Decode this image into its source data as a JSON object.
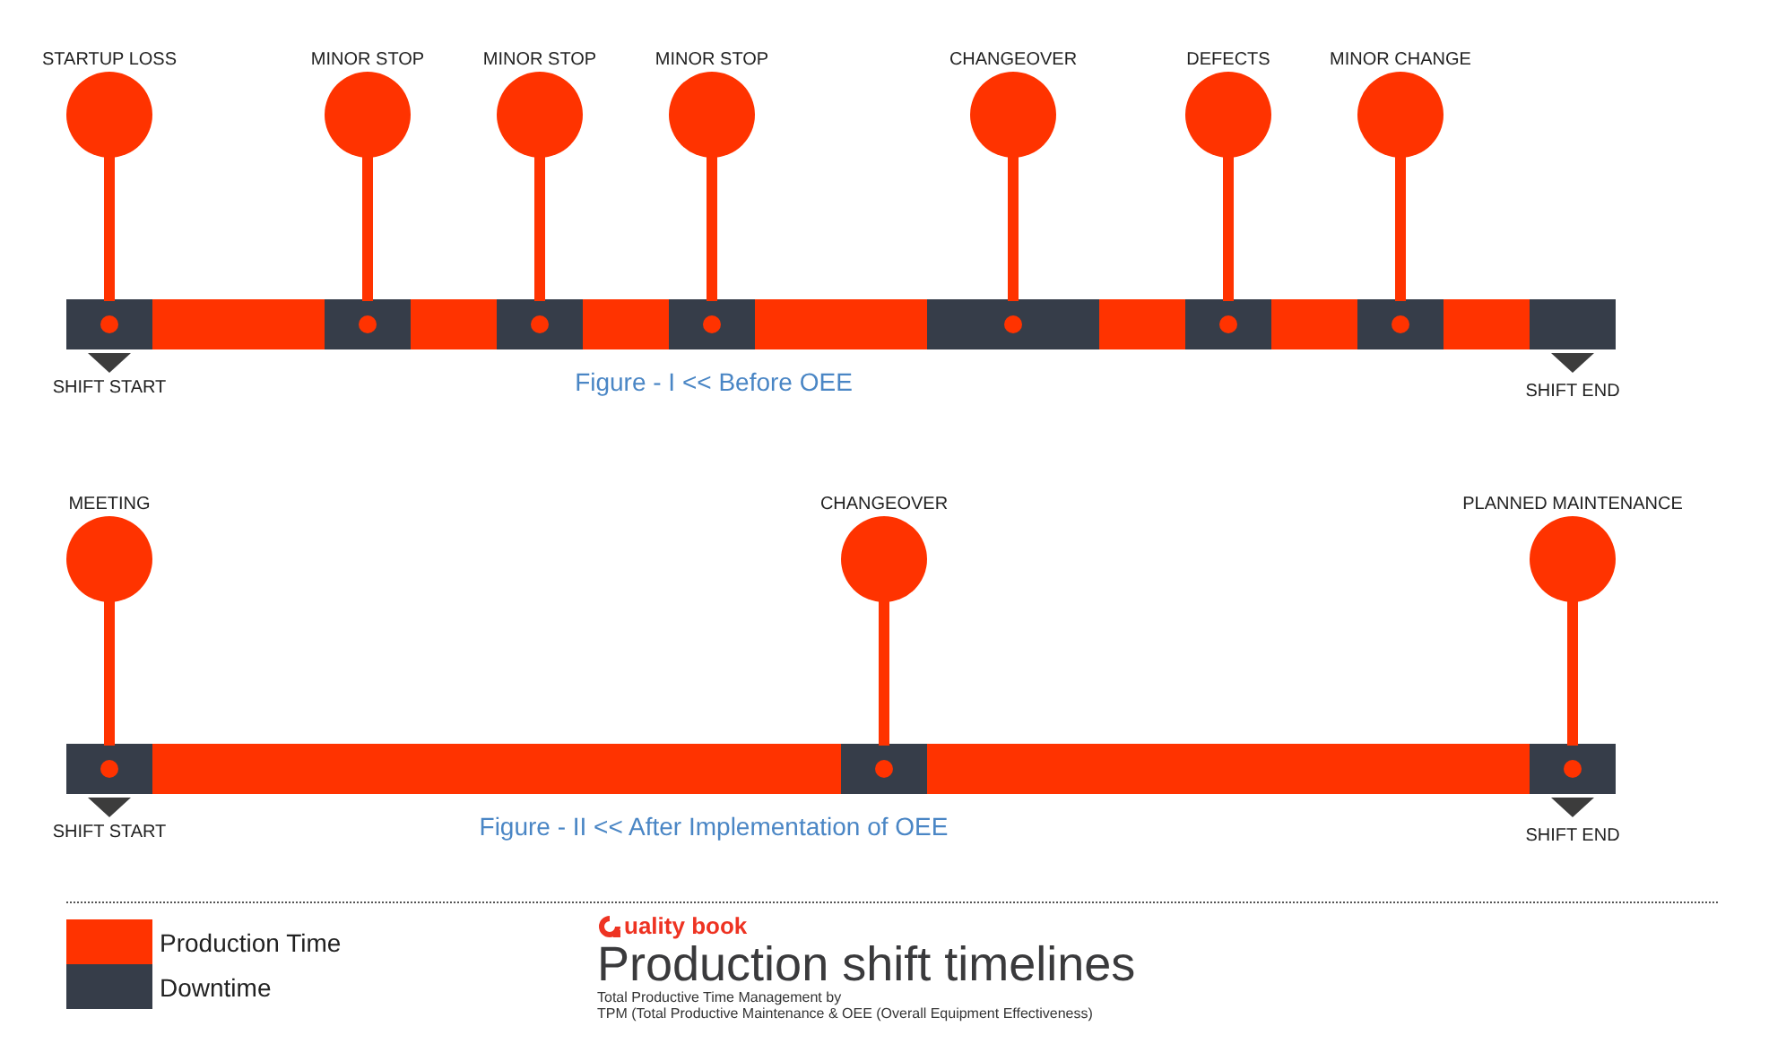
{
  "timelines": [
    {
      "caption": "Figure -  I << Before OEE",
      "start_label": "SHIFT START",
      "end_label": "SHIFT END",
      "cells": [
        {
          "kind": "downtime",
          "event": "STARTUP LOSS"
        },
        {
          "kind": "production"
        },
        {
          "kind": "production"
        },
        {
          "kind": "downtime",
          "event": "MINOR STOP"
        },
        {
          "kind": "production"
        },
        {
          "kind": "downtime",
          "event": "MINOR STOP"
        },
        {
          "kind": "production"
        },
        {
          "kind": "downtime",
          "event": "MINOR STOP"
        },
        {
          "kind": "production"
        },
        {
          "kind": "production"
        },
        {
          "kind": "downtime",
          "event": "CHANGEOVER"
        },
        {
          "kind": "downtime"
        },
        {
          "kind": "production"
        },
        {
          "kind": "downtime",
          "event": "DEFECTS"
        },
        {
          "kind": "production"
        },
        {
          "kind": "downtime",
          "event": "MINOR CHANGE"
        },
        {
          "kind": "production"
        },
        {
          "kind": "downtime"
        }
      ]
    },
    {
      "caption": "Figure -  II << After Implementation of OEE",
      "start_label": "SHIFT START",
      "end_label": "SHIFT END",
      "cells": [
        {
          "kind": "downtime",
          "event": "MEETING"
        },
        {
          "kind": "production"
        },
        {
          "kind": "production"
        },
        {
          "kind": "production"
        },
        {
          "kind": "production"
        },
        {
          "kind": "production"
        },
        {
          "kind": "production"
        },
        {
          "kind": "production"
        },
        {
          "kind": "production"
        },
        {
          "kind": "downtime",
          "event": "CHANGEOVER"
        },
        {
          "kind": "production"
        },
        {
          "kind": "production"
        },
        {
          "kind": "production"
        },
        {
          "kind": "production"
        },
        {
          "kind": "production"
        },
        {
          "kind": "production"
        },
        {
          "kind": "production"
        },
        {
          "kind": "downtime",
          "event": "PLANNED MAINTENANCE"
        }
      ]
    }
  ],
  "legend": [
    {
      "kind": "production",
      "label": "Production Time"
    },
    {
      "kind": "downtime",
      "label": "Downtime"
    }
  ],
  "brand": "uality book",
  "title": "Production shift timelines",
  "subtitle_lines": [
    "Total Productive Time Management  by",
    "TPM  (Total  Productive Maintenance & OEE  (Overall Equipment Effectiveness)"
  ]
}
